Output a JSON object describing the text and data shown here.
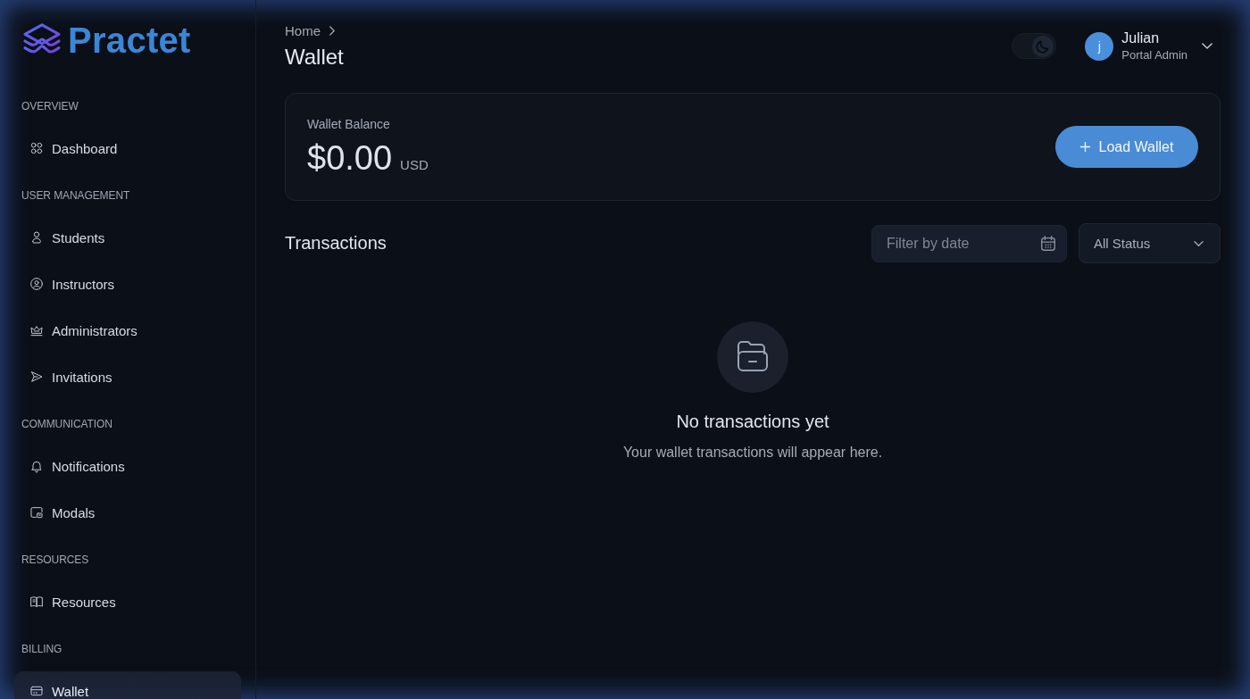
{
  "sidebar": {
    "logo": {
      "text": "Practet"
    },
    "sections": [
      {
        "heading": "OVERVIEW",
        "items": [
          {
            "label": "Dashboard",
            "selected": false
          }
        ]
      },
      {
        "heading": "USER MANAGEMENT",
        "items": [
          {
            "label": "Students",
            "selected": false
          },
          {
            "label": "Instructors",
            "selected": false
          },
          {
            "label": "Administrators",
            "selected": false
          },
          {
            "label": "Invitations",
            "selected": false
          }
        ]
      },
      {
        "heading": "COMMUNICATION",
        "items": [
          {
            "label": "Notifications",
            "selected": false
          },
          {
            "label": "Modals",
            "selected": false
          }
        ]
      },
      {
        "heading": "RESOURCES",
        "items": [
          {
            "label": "Resources",
            "selected": false
          }
        ]
      },
      {
        "heading": "BILLING",
        "items": [
          {
            "label": "Wallet",
            "selected": true
          }
        ]
      }
    ]
  },
  "header": {
    "breadcrumb": [
      "Home"
    ],
    "title": "Wallet",
    "theme_toggle": {
      "on": true
    },
    "user": {
      "initial": "j",
      "name": "Julian",
      "role": "Portal Admin"
    }
  },
  "balance_card": {
    "label": "Wallet Balance",
    "amount": "$0.00",
    "currency": "USD",
    "button": "Load Wallet"
  },
  "transactions": {
    "title": "Transactions",
    "date_filter": {
      "placeholder": "Filter by date"
    },
    "status_filter": {
      "value": "All Status"
    },
    "empty_state": {
      "title": "No transactions yet",
      "message": "Your wallet transactions will appear here."
    }
  }
}
